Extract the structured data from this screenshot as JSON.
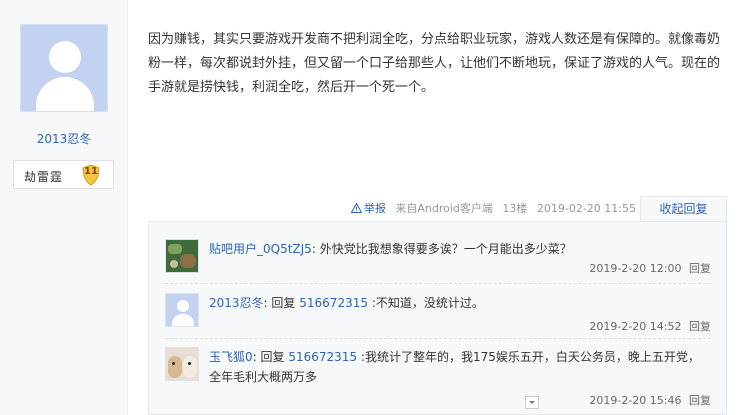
{
  "author": {
    "name": "2013忍冬",
    "badge_title": "劫雷霆",
    "level": "11"
  },
  "post": {
    "content": "因为赚钱，其实只要游戏开发商不把利润全吃，分点给职业玩家，游戏人数还是有保障的。就像毒奶粉一样，每次都说封外挂，但又留一个口子给那些人，让他们不断地玩，保证了游戏的人气。现在的手游就是捞快钱，利润全吃，然后开一个死一个。",
    "report_label": "举报",
    "client": "来自Android客户端",
    "floor": "13楼",
    "time": "2019-02-20 11:55",
    "collapse_label": "收起回复"
  },
  "replies": [
    {
      "user": "贴吧用户_0Q5tZJ5",
      "colon": ":",
      "text": "外快党比我想象得要多诶？一个月能出多少菜？",
      "time": "2019-2-20 12:00",
      "reply_label": "回复"
    },
    {
      "user": "2013忍冬",
      "colon": ":",
      "prefix": "回复",
      "target": "516672315",
      "text": ":不知道，没统计过。",
      "time": "2019-2-20 14:52",
      "reply_label": "回复"
    },
    {
      "user": "玉飞狐0",
      "colon": ":",
      "prefix": "回复",
      "target": "516672315",
      "text": ":我统计了整年的，我175娱乐五开，白天公务员，晚上五开党，全年毛利大概两万多",
      "time": "2019-2-20 15:46",
      "reply_label": "回复"
    }
  ],
  "icons": [
    "default-avatar-icon",
    "level-shield-icon",
    "warning-icon",
    "chevron-down-icon"
  ],
  "colors": {
    "link": "#2d64b3",
    "badge_gold": "#f5c542",
    "reply_bg": "#f7f8fa"
  }
}
